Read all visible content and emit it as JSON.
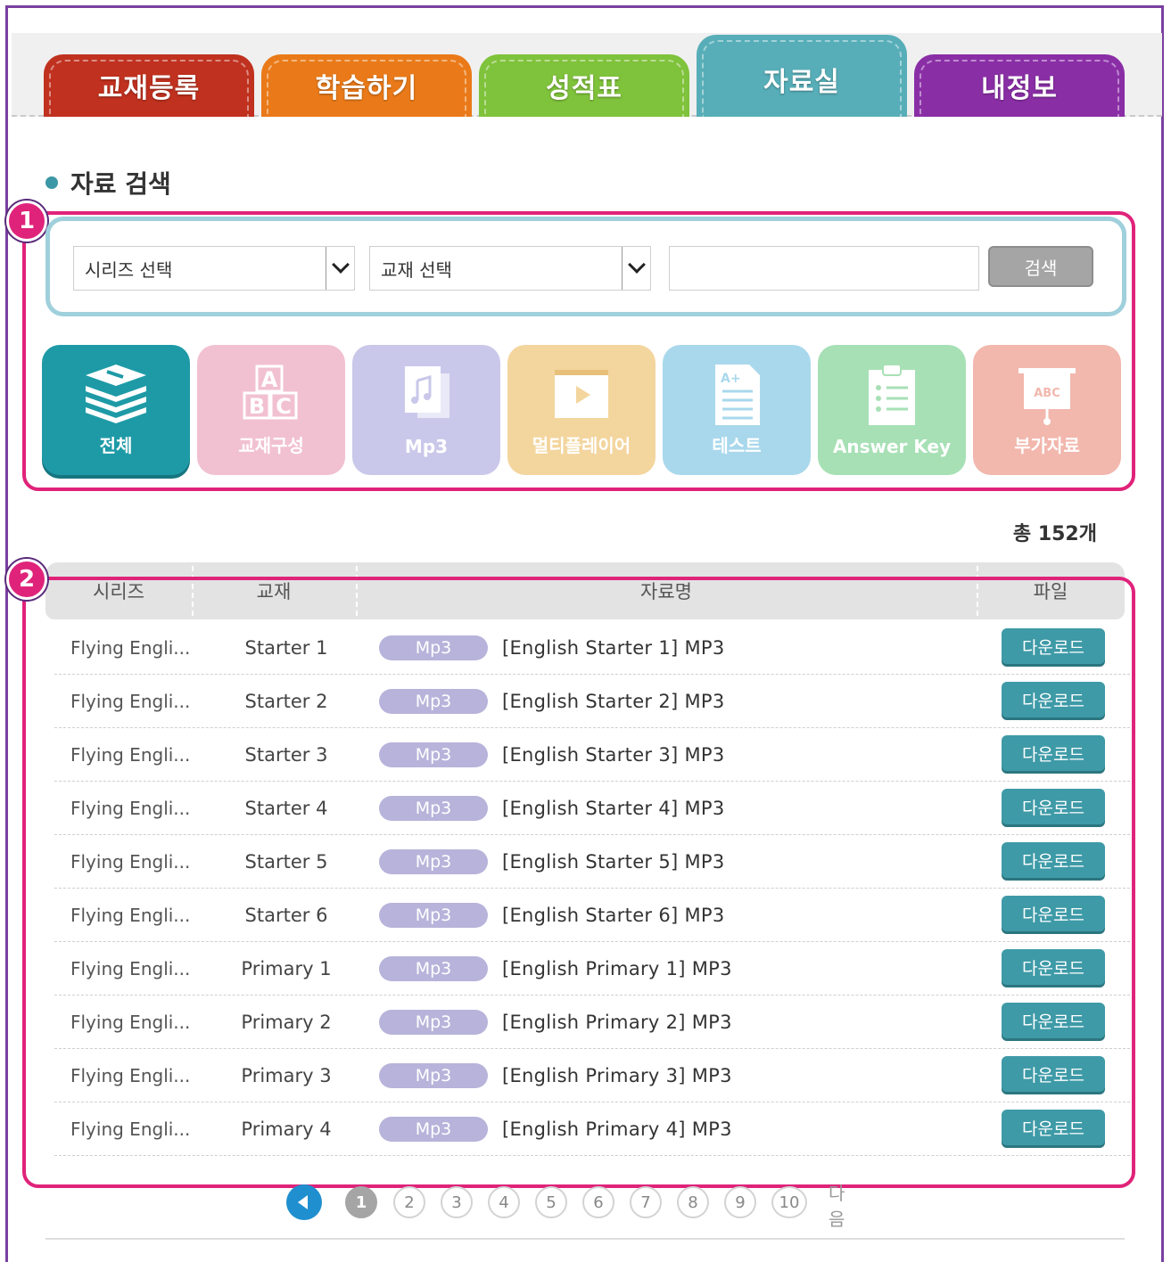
{
  "tabs": [
    {
      "label": "교재등록",
      "color": "#c0311f"
    },
    {
      "label": "학습하기",
      "color": "#ea7a19"
    },
    {
      "label": "성적표",
      "color": "#7fc23b"
    },
    {
      "label": "자료실",
      "color": "#57aeb8",
      "active": true
    },
    {
      "label": "내정보",
      "color": "#8a2ea6"
    }
  ],
  "section_title": "자료 검색",
  "callouts": [
    "1",
    "2"
  ],
  "search": {
    "series_select": "시리즈 선택",
    "book_select": "교재 선택",
    "input_value": "",
    "button": "검색"
  },
  "categories": [
    {
      "label": "전체",
      "icon": "stack-books-icon",
      "color": "#1e9aa6",
      "active": true
    },
    {
      "label": "교재구성",
      "icon": "abc-blocks-icon",
      "color": "#f1c1d1"
    },
    {
      "label": "Mp3",
      "icon": "music-file-icon",
      "color": "#c9c8ea"
    },
    {
      "label": "멀티플레이어",
      "icon": "video-player-icon",
      "color": "#f3d59e"
    },
    {
      "label": "테스트",
      "icon": "test-sheet-icon",
      "color": "#a9d8ec"
    },
    {
      "label": "Answer Key",
      "icon": "clipboard-checklist-icon",
      "color": "#a7e0b5"
    },
    {
      "label": "부가자료",
      "icon": "presentation-board-icon",
      "color": "#f2b7ad"
    }
  ],
  "total": {
    "prefix": "총 ",
    "count": "152",
    "suffix": "개"
  },
  "table": {
    "headers": [
      "시리즈",
      "교재",
      "자료명",
      "파일"
    ],
    "rows": [
      {
        "series": "Flying Engli...",
        "book": "Starter 1",
        "type": "Mp3",
        "name": "[English Starter 1] MP3",
        "file": "다운로드"
      },
      {
        "series": "Flying Engli...",
        "book": "Starter 2",
        "type": "Mp3",
        "name": "[English Starter 2] MP3",
        "file": "다운로드"
      },
      {
        "series": "Flying Engli...",
        "book": "Starter 3",
        "type": "Mp3",
        "name": "[English Starter 3] MP3",
        "file": "다운로드"
      },
      {
        "series": "Flying Engli...",
        "book": "Starter 4",
        "type": "Mp3",
        "name": "[English Starter 4] MP3",
        "file": "다운로드"
      },
      {
        "series": "Flying Engli...",
        "book": "Starter 5",
        "type": "Mp3",
        "name": "[English Starter 5] MP3",
        "file": "다운로드"
      },
      {
        "series": "Flying Engli...",
        "book": "Starter 6",
        "type": "Mp3",
        "name": "[English Starter 6] MP3",
        "file": "다운로드"
      },
      {
        "series": "Flying Engli...",
        "book": "Primary 1",
        "type": "Mp3",
        "name": "[English Primary 1] MP3",
        "file": "다운로드"
      },
      {
        "series": "Flying Engli...",
        "book": "Primary 2",
        "type": "Mp3",
        "name": "[English Primary 2] MP3",
        "file": "다운로드"
      },
      {
        "series": "Flying Engli...",
        "book": "Primary 3",
        "type": "Mp3",
        "name": "[English Primary 3] MP3",
        "file": "다운로드"
      },
      {
        "series": "Flying Engli...",
        "book": "Primary 4",
        "type": "Mp3",
        "name": "[English Primary 4] MP3",
        "file": "다운로드"
      }
    ]
  },
  "pagination": {
    "pages": [
      "1",
      "2",
      "3",
      "4",
      "5",
      "6",
      "7",
      "8",
      "9",
      "10"
    ],
    "current": "1",
    "next_label": "다음"
  }
}
